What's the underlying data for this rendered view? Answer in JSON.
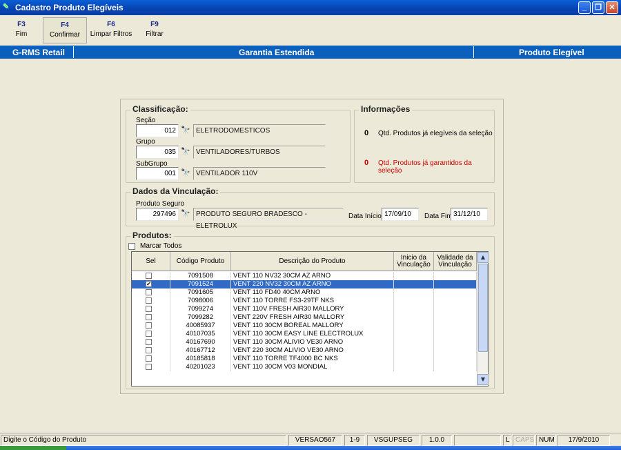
{
  "window": {
    "title": "Cadastro Produto Elegíveis"
  },
  "toolbar": {
    "buttons": [
      {
        "key": "F3",
        "label": "Fim"
      },
      {
        "key": "F4",
        "label": "Confirmar"
      },
      {
        "key": "F6",
        "label": "Limpar Filtros"
      },
      {
        "key": "F9",
        "label": "Filtrar"
      }
    ]
  },
  "header": {
    "left": "G-RMS Retail",
    "center": "Garantia Estendida",
    "right": "Produto Elegível"
  },
  "classificacao": {
    "legend": "Classificação:",
    "secao": {
      "label": "Seção",
      "code": "012",
      "desc": "ELETRODOMESTICOS"
    },
    "grupo": {
      "label": "Grupo",
      "code": "035",
      "desc": "VENTILADORES/TURBOS"
    },
    "subgrupo": {
      "label": "SubGrupo",
      "code": "001",
      "desc": "VENTILADOR 110V"
    }
  },
  "informacoes": {
    "legend": "Informações",
    "elegiveis": {
      "count": "0",
      "label": "Qtd. Produtos já elegíveis da seleção"
    },
    "garantidos": {
      "count": "0",
      "label": "Qtd. Produtos já garantidos da seleção"
    }
  },
  "vinculacao": {
    "legend": "Dados da Vinculação:",
    "produto_seguro": {
      "label": "Produto Seguro",
      "code": "297496",
      "desc": "PRODUTO SEGURO BRADESCO - ELETROLUX"
    },
    "data_inicio": {
      "label": "Data Início",
      "value": "17/09/10"
    },
    "data_fim": {
      "label": "Data Fim",
      "value": "31/12/10"
    }
  },
  "produtos": {
    "legend": "Produtos:",
    "marcar_todos": "Marcar Todos",
    "columns": [
      "Sel",
      "Código Produto",
      "Descrição do Produto",
      "Inicio da Vinculação",
      "Validade da Vinculação"
    ],
    "rows": [
      {
        "checked": false,
        "code": "7091508",
        "desc": "VENT 110 NV32 30CM AZ ARNO"
      },
      {
        "checked": true,
        "code": "7091524",
        "desc": "VENT 220 NV32 30CM AZ ARNO"
      },
      {
        "checked": false,
        "code": "7091605",
        "desc": "VENT 110 FD40 40CM ARNO"
      },
      {
        "checked": false,
        "code": "7098006",
        "desc": "VENT 110 TORRE FS3-29TF NKS"
      },
      {
        "checked": false,
        "code": "7099274",
        "desc": "VENT 110V FRESH AIR30 MALLORY"
      },
      {
        "checked": false,
        "code": "7099282",
        "desc": "VENT 220V FRESH AIR30 MALLORY"
      },
      {
        "checked": false,
        "code": "40085937",
        "desc": "VENT 110 30CM BOREAL MALLORY"
      },
      {
        "checked": false,
        "code": "40107035",
        "desc": "VENT 110 30CM EASY LINE ELECTROLUX"
      },
      {
        "checked": false,
        "code": "40167690",
        "desc": "VENT 110 30CM ALIVIO VE30 ARNO"
      },
      {
        "checked": false,
        "code": "40167712",
        "desc": "VENT 220 30CM ALIVIO VE30 ARNO"
      },
      {
        "checked": false,
        "code": "40185818",
        "desc": "VENT 110 TORRE TF4000 BC NKS"
      },
      {
        "checked": false,
        "code": "40201023",
        "desc": "VENT 110 30CM V03 MONDIAL"
      }
    ],
    "selected_row": 1
  },
  "status": {
    "message": "Digite o Código do Produto",
    "version": "VERSAO567",
    "range": "1-9",
    "program": "VSGUPSEG",
    "build": "1.0.0",
    "l": "L",
    "caps": "CAPS",
    "num": "NUM",
    "date": "17/9/2010"
  },
  "colors": {
    "title_bar": "#0A5FD6",
    "header_bar": "#0B5FBD",
    "selection": "#316AC5",
    "warning_text": "#CC0000",
    "toolbar_key": "#1A2A8A"
  }
}
